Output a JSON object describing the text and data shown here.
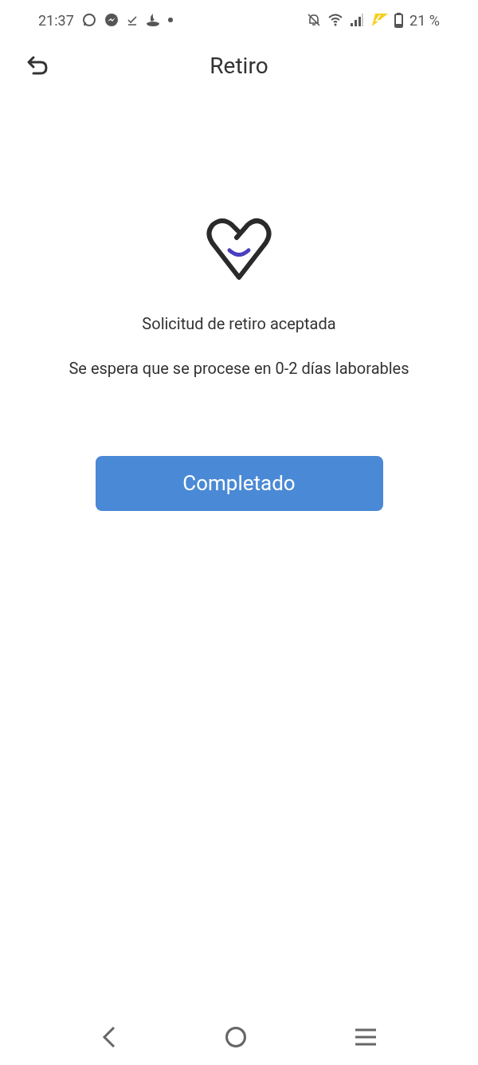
{
  "status_bar": {
    "time": "21:37",
    "battery": "21 %"
  },
  "header": {
    "title": "Retiro"
  },
  "message": {
    "title": "Solicitud de retiro aceptada",
    "detail": "Se espera que se procese en 0-2 días laborables"
  },
  "button": {
    "label": "Completado"
  }
}
